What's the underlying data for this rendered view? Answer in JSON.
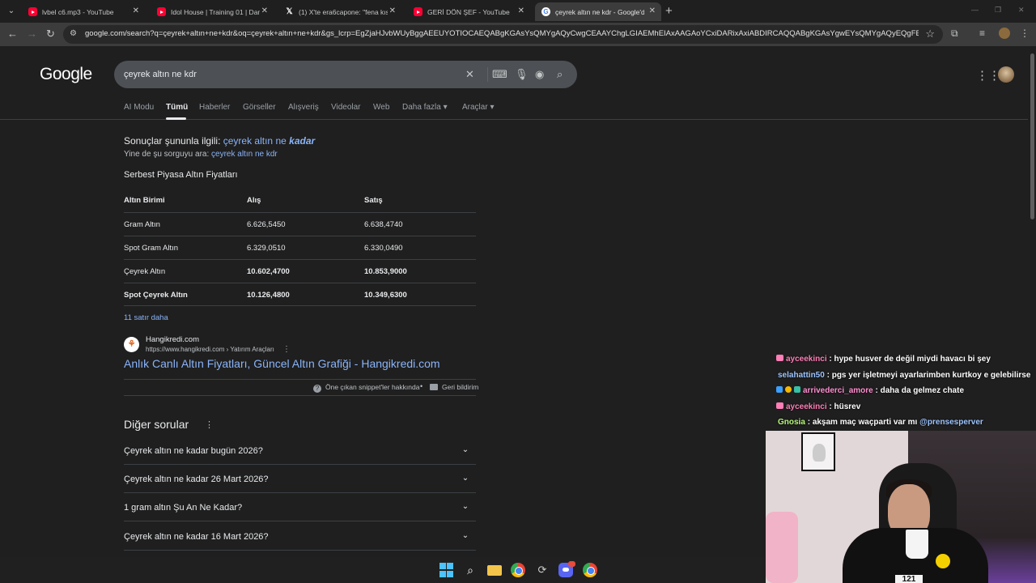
{
  "browser": {
    "tabs": [
      {
        "title": "lvbel c6.mp3 - YouTube",
        "favicon": "youtube-icon"
      },
      {
        "title": "Idol House | Training 01 | Dans",
        "favicon": "youtube-icon"
      },
      {
        "title": "(1) X'te era6capone: \"fena kıska",
        "favicon": "x-icon"
      },
      {
        "title": "GERİ DÖN ŞEF - YouTube",
        "favicon": "youtube-icon"
      },
      {
        "title": "çeyrek altın ne kdr - Google'da",
        "favicon": "google-icon"
      }
    ],
    "url": "google.com/search?q=çeyrek+altın+ne+kdr&oq=çeyrek+altın+ne+kdr&gs_lcrp=EgZjaHJvbWUyBggAEEUYOTIOCAEQABgKGAsYsQMYgAQyCwgCEAAYChgLGIAEMhEIAxAAGAoYCxiDARixAxiABDIRCAQQABgKGAsYgwEYsQMYgAQyEQgFEAAYChgLGIM..."
  },
  "search": {
    "logo": "Google",
    "query": "çeyrek altın ne kdr"
  },
  "nav_tabs": [
    "AI Modu",
    "Tümü",
    "Haberler",
    "Görseller",
    "Alışveriş",
    "Videolar",
    "Web",
    "Daha fazla",
    "Araçlar"
  ],
  "active_tab": "Tümü",
  "correction": {
    "prefix": "Sonuçlar şununla ilgili:",
    "link_plain": "çeyrek altın ne",
    "link_emph": "kadar",
    "alt_prefix": "Yine de şu sorguyu ara:",
    "alt_link": "çeyrek altın ne kdr"
  },
  "snippet": {
    "title": "Serbest Piyasa Altın Fiyatları",
    "headers": [
      "Altın Birimi",
      "Alış",
      "Satış"
    ],
    "rows": [
      {
        "name": "Gram Altın",
        "buy": "6.626,5450",
        "sell": "6.638,4740"
      },
      {
        "name": "Spot Gram Altın",
        "buy": "6.329,0510",
        "sell": "6.330,0490"
      },
      {
        "name": "Çeyrek Altın",
        "buy": "10.602,4700",
        "sell": "10.853,9000"
      },
      {
        "name": "Spot Çeyrek Altın",
        "buy": "10.126,4800",
        "sell": "10.349,6300"
      }
    ],
    "more": "11 satır daha",
    "source_name": "Hangikredi.com",
    "source_url": "https://www.hangikredi.com › Yatırım Araçları",
    "result_title": "Anlık Canlı Altın Fiyatları, Güncel Altın Grafiği - Hangikredi.com",
    "feedback_about": "Öne çıkan snippet'ler hakkında",
    "feedback_dot": "•",
    "feedback": "Geri bildirim"
  },
  "paa": {
    "title": "Diğer sorular",
    "questions": [
      "Çeyrek altın ne kadar bugün 2026?",
      "Çeyrek altın ne kadar 26 Mart 2026?",
      "1 gram altın Şu An Ne Kadar?",
      "Çeyrek altın ne kadar 16 Mart 2026?"
    ]
  },
  "chat": [
    {
      "user": "ayceekinci",
      "sep": ":",
      "msg": "hype husver de değil miydi havacı bi şey",
      "color": "#ff7eb6"
    },
    {
      "user": "selahattin50",
      "sep": ":",
      "msg": "pgs yer işletmeyi ayarlarimben kurtkoy e gelebilirse",
      "color": "#9ec5ff"
    },
    {
      "user": "arrivederci_amore",
      "sep": ":",
      "msg": "daha da gelmez chate",
      "color": "#ff8fd0"
    },
    {
      "user": "ayceekinci",
      "sep": ":",
      "msg": "hüsrev",
      "color": "#ff7eb6"
    },
    {
      "user": "Gnosia",
      "sep": ":",
      "msg": "akşam maç waçparti var mı",
      "mention": "@prensesperver",
      "color": "#b8f77a"
    }
  ],
  "webcam": {
    "jersey_number": "121"
  }
}
